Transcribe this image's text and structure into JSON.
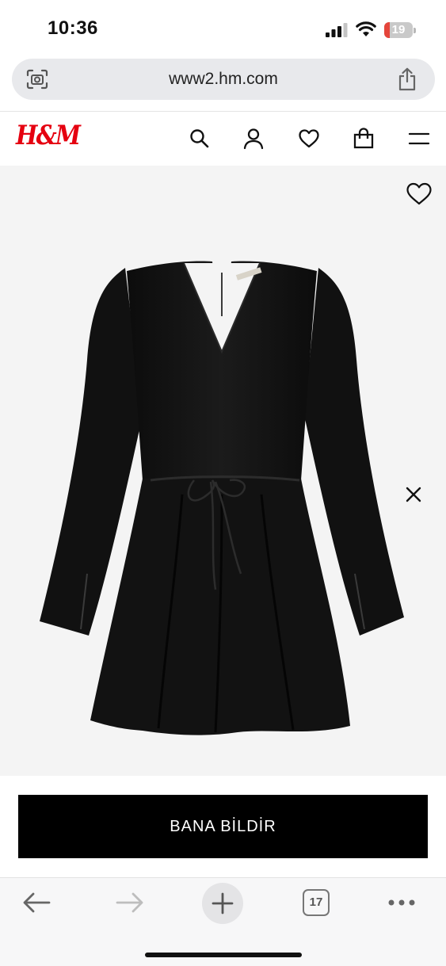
{
  "status_bar": {
    "time": "10:36",
    "battery_level": "19",
    "battery_fraction": 0.19,
    "battery_color": "#e5453b",
    "icons": [
      "cellular-signal-icon",
      "wifi-icon",
      "battery-icon"
    ]
  },
  "browser": {
    "url": "www2.hm.com",
    "left_icon": "page-scan-icon",
    "right_icon": "share-icon",
    "open_tabs": "17",
    "toolbar_icons": [
      "back-arrow-icon",
      "forward-arrow-icon",
      "new-tab-plus-icon",
      "tabs-icon",
      "more-icon"
    ]
  },
  "header": {
    "logo": "H&M",
    "brand_color": "#e50010",
    "icons": [
      "search-icon",
      "account-icon",
      "favorites-heart-icon",
      "shopping-bag-icon",
      "menu-icon"
    ]
  },
  "product": {
    "image_icon": "black-dress-image",
    "wishlist_icon": "heart-outline-icon",
    "close_icon": "close-icon"
  },
  "cta": {
    "label": "BANA BİLDİR"
  }
}
